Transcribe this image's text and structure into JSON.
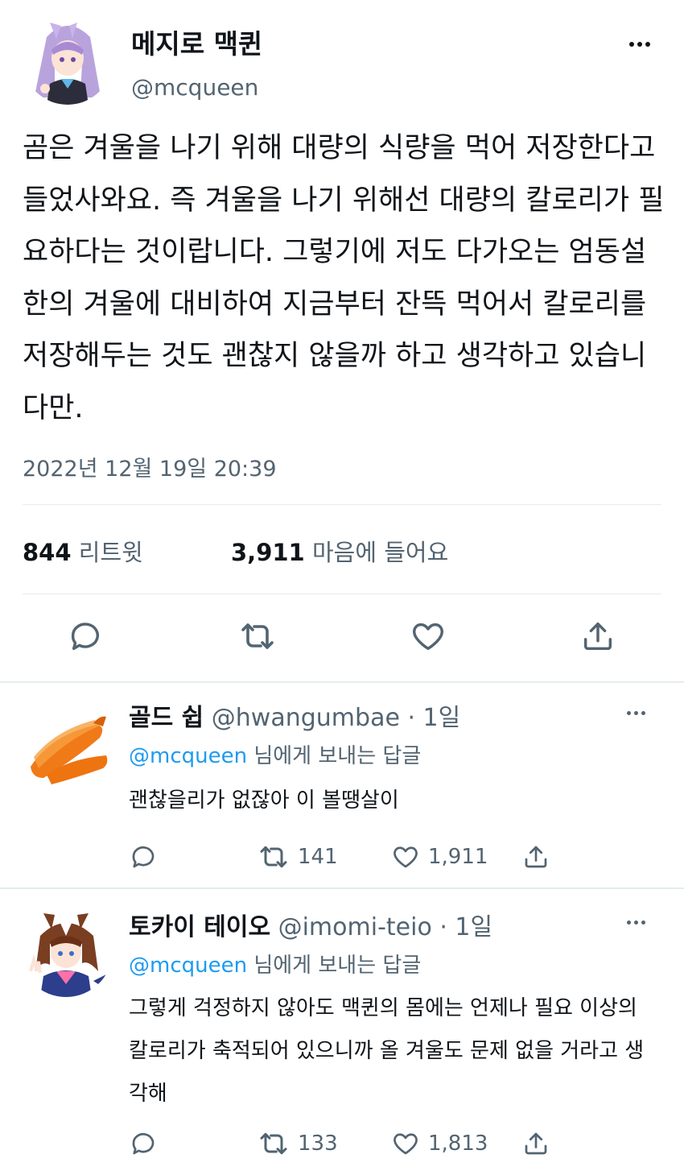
{
  "tweet": {
    "display_name": "메지로 맥퀸",
    "handle": "@mcqueen",
    "text_lines": [
      "곰은 겨울을 나기 위해 대량의 식량을 먹어 저장한다고",
      "들었사와요. 즉 겨울을 나기 위해선 대량의 칼로리가 필",
      "요하다는 것이랍니다. 그렇기에 저도 다가오는 엄동설",
      "한의 겨울에 대비하여 지금부터 잔뜩 먹어서 칼로리를",
      "저장해두는 것도 괜찮지 않을까 하고 생각하고 있습니",
      "다만."
    ],
    "timestamp": "2022년 12월 19일 20:39",
    "retweets_count": "844",
    "retweets_label": "리트윗",
    "likes_count": "3,911",
    "likes_label": "마음에 들어요"
  },
  "replies": [
    {
      "name": "골드 쉽",
      "handle": "@hwangumbae",
      "time": "· 1일",
      "reply_to_mention": "@mcqueen",
      "reply_to_rest": "님에게 보내는 답글",
      "text_lines": [
        "괜찮을리가 없잖아 이 볼땡살이"
      ],
      "retweets": "141",
      "likes": "1,911"
    },
    {
      "name": "토카이 테이오",
      "handle": "@imomi-teio",
      "time": "· 1일",
      "reply_to_mention": "@mcqueen",
      "reply_to_rest": "님에게 보내는 답글",
      "text_lines": [
        "그렇게 걱정하지 않아도 맥퀸의 몸에는 언제나 필요 이상의",
        "칼로리가 축적되어 있으니까 올 겨울도 문제 없을 거라고 생",
        "각해"
      ],
      "retweets": "133",
      "likes": "1,813"
    }
  ],
  "icons": {
    "reply": "reply-icon",
    "retweet": "retweet-icon",
    "like": "heart-icon",
    "share": "share-icon",
    "more": "more-icon"
  },
  "colors": {
    "text": "#0f1419",
    "secondary": "#536471",
    "link": "#1d9bf0",
    "divider": "#e6ecf0"
  }
}
